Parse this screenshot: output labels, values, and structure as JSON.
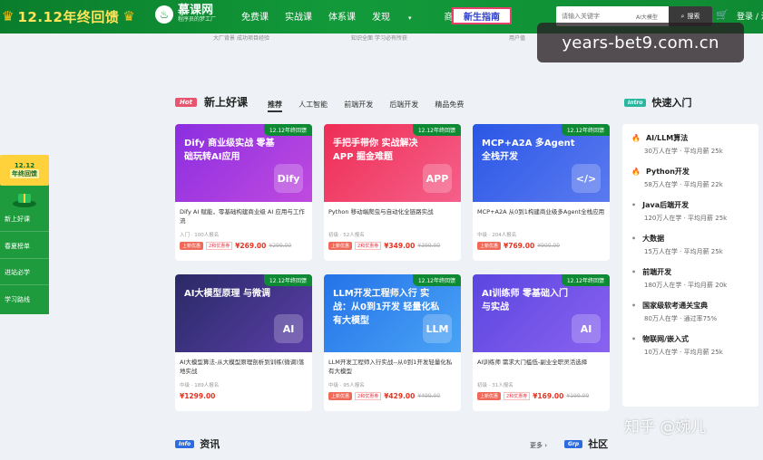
{
  "topbar": {
    "promo": "12.12年终回馈",
    "logo_name": "慕课网",
    "logo_sub": "程序员的梦工厂",
    "nav": [
      "免费课",
      "实战课",
      "体系课",
      "发现",
      "商业合作"
    ],
    "guide": "新生指南",
    "search_placeholder": "请输入关键字",
    "search_tag": "AI大模型",
    "search_button": "搜索",
    "login": "登录 / 注"
  },
  "prev_strip": [
    "大厂背景 成功项目经验",
    "知识全面 学习必有所获",
    "用户值"
  ],
  "watermark_top": "years-bet9.com.cn",
  "section": {
    "badge": "Hot",
    "title": "新上好课",
    "tabs": [
      "推荐",
      "人工智能",
      "前端开发",
      "后端开发",
      "精品免费"
    ]
  },
  "ribbon": "12.12年终回馈",
  "cards": [
    {
      "banner": "Dify 商业级实战 零基础玩转AI应用",
      "art": "Dify",
      "desc": "Dify AI 赋能，零基础构建商业级 AI 应用与工作流",
      "meta": "入门 · 100人报名",
      "sale": "上新优惠",
      "coupon": "2和优惠券",
      "price": "¥269.00",
      "old": "¥299.00"
    },
    {
      "banner": "手把手带你 实战解决 APP 掘金难题",
      "art": "APP",
      "desc": "Python 移动端爬虫与自动化全链路实战",
      "meta": "初级 · 52人报名",
      "sale": "上新优惠",
      "coupon": "2和优惠券",
      "price": "¥349.00",
      "old": "¥399.00"
    },
    {
      "banner": "MCP+A2A 多Agent全栈开发",
      "art": "</>",
      "desc": "MCP+A2A 从0到1构建商业级多Agent全栈应用",
      "meta": "中级 · 204人报名",
      "sale": "上新优惠",
      "coupon": "",
      "price": "¥769.00",
      "old": "¥900.00"
    },
    {
      "banner": "AI大模型原理 与微调",
      "art": "AI",
      "desc": "AI大模型算法-从大模型原理剖析到训练(微调)落地实战",
      "meta": "中级 · 189人报名",
      "sale": "",
      "coupon": "",
      "price": "¥1299.00",
      "old": ""
    },
    {
      "banner": "LLM开发工程师入行 实战：从0到1开发 轻量化私有大模型",
      "art": "LLM",
      "desc": "LLM开发工程师入行实战--从0到1开发轻量化私有大模型",
      "meta": "中级 · 95人报名",
      "sale": "上新优惠",
      "coupon": "2和优惠券",
      "price": "¥429.00",
      "old": "¥499.00"
    },
    {
      "banner": "AI训练师 零基础入门与实战",
      "art": "AI",
      "desc": "AI训练师 需求大门槛低-副业全职灵活选择",
      "meta": "初级 · 31人报名",
      "sale": "上新优惠",
      "coupon": "2和优惠券",
      "price": "¥169.00",
      "old": "¥199.00"
    }
  ],
  "quick": {
    "badge": "Intro",
    "title": "快速入门",
    "items": [
      {
        "name": "AI/LLM算法",
        "sub": "30万人在学 · 平均月薪 25k",
        "hot": true
      },
      {
        "name": "Python开发",
        "sub": "58万人在学 · 平均月薪 22k",
        "hot": true
      },
      {
        "name": "Java后端开发",
        "sub": "120万人在学 · 平均月薪 25k",
        "hot": false
      },
      {
        "name": "大数据",
        "sub": "15万人在学 · 平均月薪 25k",
        "hot": false
      },
      {
        "name": "前端开发",
        "sub": "180万人在学 · 平均月薪 20k",
        "hot": false
      },
      {
        "name": "国家级软考通关宝典",
        "sub": "80万人在学 · 通过率75%",
        "hot": false
      },
      {
        "name": "物联网/嵌入式",
        "sub": "10万人在学 · 平均月薪 25k",
        "hot": false
      }
    ]
  },
  "left_float": {
    "year": "12.12",
    "title": "年终回馈",
    "items": [
      "新上好课",
      "春夏榜单",
      "进站必学",
      "学习路线"
    ]
  },
  "bottom": {
    "info_badge": "Info",
    "info_title": "资讯",
    "more": "更多 ›",
    "grp_badge": "Grp",
    "grp_title": "社区"
  },
  "watermark_bottom": "知乎 @婉儿"
}
